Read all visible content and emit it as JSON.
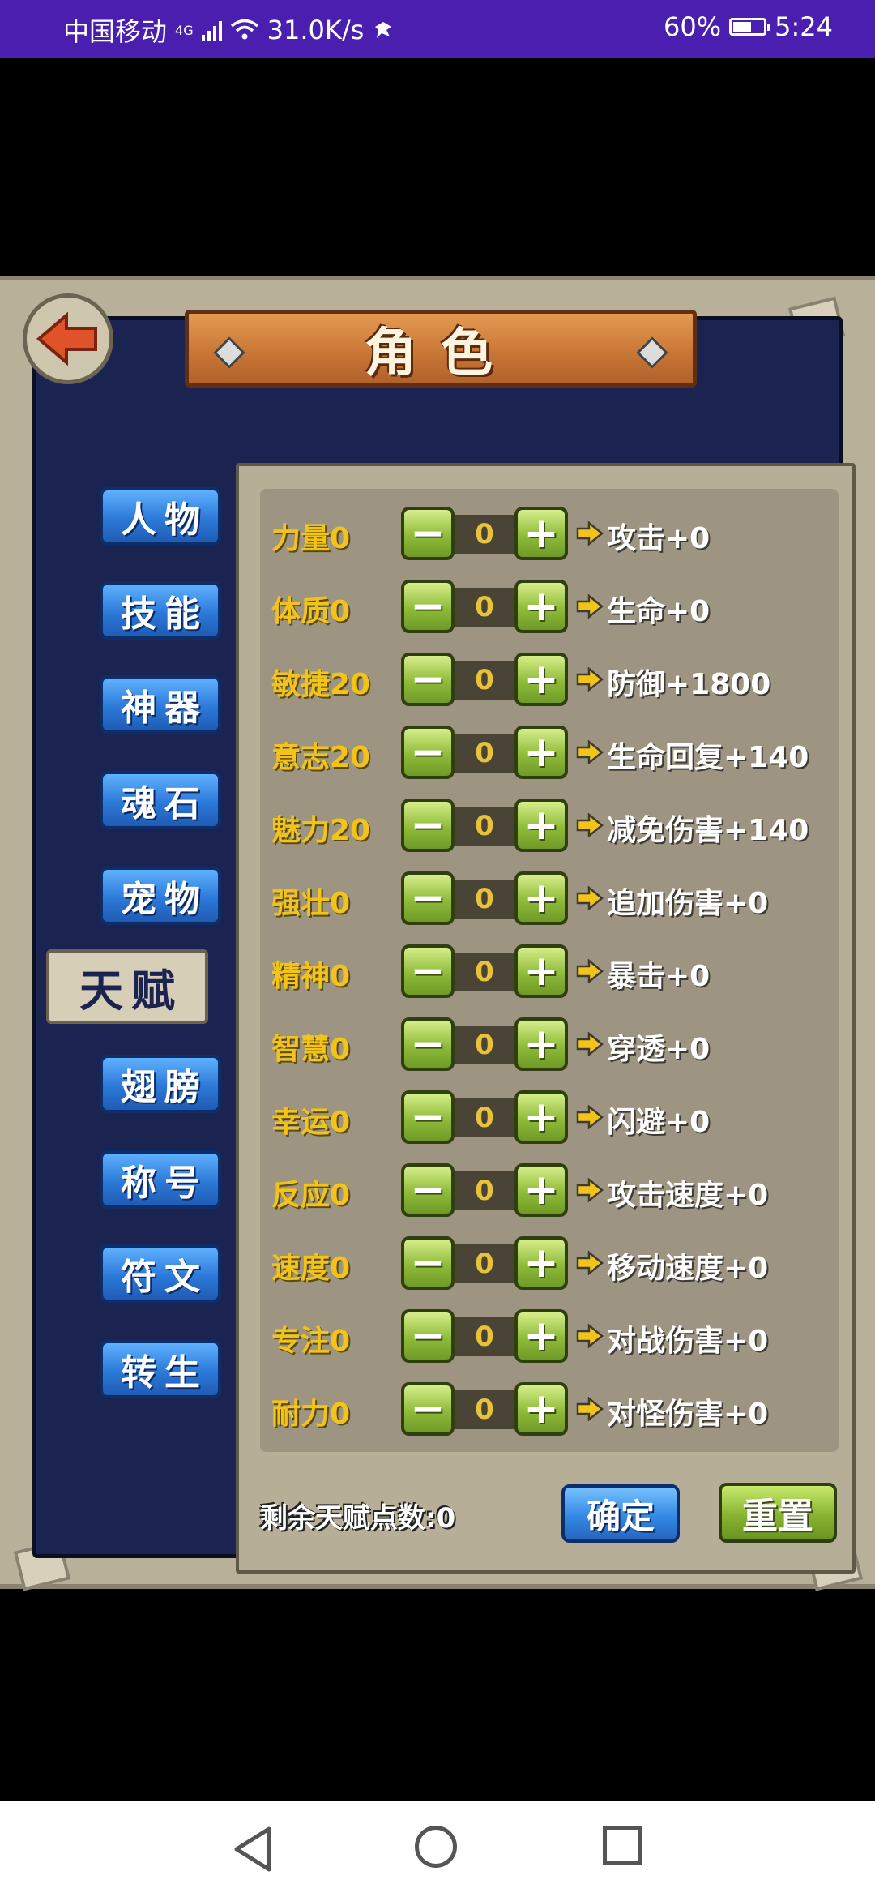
{
  "status_bar": {
    "carrier": "中国移动",
    "network": "4G",
    "speed": "31.0K/s",
    "battery": "60%",
    "battery_level": 0.6,
    "time": "5:24"
  },
  "title": "角色",
  "tabs": [
    {
      "label": "人物",
      "active": false
    },
    {
      "label": "技能",
      "active": false
    },
    {
      "label": "神器",
      "active": false
    },
    {
      "label": "魂石",
      "active": false
    },
    {
      "label": "宠物",
      "active": false
    },
    {
      "label": "天赋",
      "active": true
    },
    {
      "label": "翅膀",
      "active": false
    },
    {
      "label": "称号",
      "active": false
    },
    {
      "label": "符文",
      "active": false
    },
    {
      "label": "转生",
      "active": false
    }
  ],
  "stats": [
    {
      "name": "力量0",
      "value": "0",
      "effect": "攻击+0"
    },
    {
      "name": "体质0",
      "value": "0",
      "effect": "生命+0"
    },
    {
      "name": "敏捷20",
      "value": "0",
      "effect": "防御+1800"
    },
    {
      "name": "意志20",
      "value": "0",
      "effect": "生命回复+140"
    },
    {
      "name": "魅力20",
      "value": "0",
      "effect": "减免伤害+140"
    },
    {
      "name": "强壮0",
      "value": "0",
      "effect": "追加伤害+0"
    },
    {
      "name": "精神0",
      "value": "0",
      "effect": "暴击+0"
    },
    {
      "name": "智慧0",
      "value": "0",
      "effect": "穿透+0"
    },
    {
      "name": "幸运0",
      "value": "0",
      "effect": "闪避+0"
    },
    {
      "name": "反应0",
      "value": "0",
      "effect": "攻击速度+0"
    },
    {
      "name": "速度0",
      "value": "0",
      "effect": "移动速度+0"
    },
    {
      "name": "专注0",
      "value": "0",
      "effect": "对战伤害+0"
    },
    {
      "name": "耐力0",
      "value": "0",
      "effect": "对怪伤害+0"
    }
  ],
  "remaining_points": "剩余天赋点数:0",
  "confirm_label": "确定",
  "reset_label": "重置",
  "colors": {
    "status_bar": "#4a1fb0",
    "frame_bg": "#1b2450",
    "stat_name": "#f2c419",
    "tab_blue": "#2c79d8",
    "button_green": "#8fbb3a"
  }
}
